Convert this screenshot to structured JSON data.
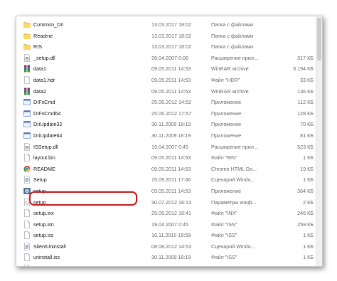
{
  "files": [
    {
      "name": "Common_Dri",
      "date": "13.03.2017 18:02",
      "type": "Папка с файлами",
      "size": "",
      "icon": "folder-icon"
    },
    {
      "name": "Readme",
      "date": "13.03.2017 18:02",
      "type": "Папка с файлами",
      "size": "",
      "icon": "folder-icon"
    },
    {
      "name": "RIS",
      "date": "13.03.2017 18:02",
      "type": "Папка с файлами",
      "size": "",
      "icon": "folder-icon"
    },
    {
      "name": "_setup.dll",
      "date": "28.04.2007 0:06",
      "type": "Расширение прил...",
      "size": "317 КБ",
      "icon": "dll-icon"
    },
    {
      "name": "data1",
      "date": "09.05.2011 14:53",
      "type": "WinRAR archive",
      "size": "3 194 КБ",
      "icon": "archive-icon"
    },
    {
      "name": "data1.hdr",
      "date": "09.05.2011 14:53",
      "type": "Файл \"HDR\"",
      "size": "33 КБ",
      "icon": "file-icon"
    },
    {
      "name": "data2",
      "date": "09.05.2011 14:53",
      "type": "WinRAR archive",
      "size": "136 КБ",
      "icon": "archive-icon"
    },
    {
      "name": "DIFxCmd",
      "date": "25.06.2012 14:52",
      "type": "Приложение",
      "size": "112 КБ",
      "icon": "app-icon"
    },
    {
      "name": "DIFxCmd64",
      "date": "25.06.2012 17:57",
      "type": "Приложение",
      "size": "128 КБ",
      "icon": "app-icon"
    },
    {
      "name": "DriUpdate32",
      "date": "30.11.2009 18:19",
      "type": "Приложение",
      "size": "70 КБ",
      "icon": "app-icon"
    },
    {
      "name": "DriUpdate64",
      "date": "30.11.2009 18:19",
      "type": "Приложение",
      "size": "81 КБ",
      "icon": "app-icon"
    },
    {
      "name": "ISSetup.dll",
      "date": "19.04.2007 0:45",
      "type": "Расширение прил...",
      "size": "523 КБ",
      "icon": "dll-icon"
    },
    {
      "name": "layout.bin",
      "date": "09.05.2011 14:53",
      "type": "Файл \"BIN\"",
      "size": "1 КБ",
      "icon": "file-icon"
    },
    {
      "name": "README",
      "date": "09.05.2011 14:53",
      "type": "Chrome HTML Do...",
      "size": "19 КБ",
      "icon": "chrome-icon"
    },
    {
      "name": "Setup",
      "date": "15.09.2011 17:46",
      "type": "Сценарий Windo...",
      "size": "1 КБ",
      "icon": "script-icon"
    },
    {
      "name": "setup",
      "date": "09.05.2011 14:53",
      "type": "Приложение",
      "size": "364 КБ",
      "icon": "setup-icon"
    },
    {
      "name": "setup",
      "date": "30.07.2012 16:13",
      "type": "Параметры конф...",
      "size": "2 КБ",
      "icon": "ini-icon"
    },
    {
      "name": "setup.inx",
      "date": "25.06.2012 16:41",
      "type": "Файл \"INX\"",
      "size": "246 КБ",
      "icon": "file-icon"
    },
    {
      "name": "setup.isn",
      "date": "19.04.2007 0:45",
      "type": "Файл \"ISN\"",
      "size": "259 КБ",
      "icon": "file-icon"
    },
    {
      "name": "setup.iss",
      "date": "10.11.2010 18:59",
      "type": "Файл \"ISS\"",
      "size": "1 КБ",
      "icon": "file-icon"
    },
    {
      "name": "SilentUninstall",
      "date": "08.08.2012 14:53",
      "type": "Сценарий Windo...",
      "size": "1 КБ",
      "icon": "script-icon"
    },
    {
      "name": "uninstall.iss",
      "date": "30.11.2009 18:19",
      "type": "Файл \"ISS\"",
      "size": "1 КБ",
      "icon": "file-icon"
    },
    {
      "name": "update.iss",
      "date": "30.04.2009 14:55",
      "type": "Файл \"ISS\"",
      "size": "1 КБ",
      "icon": "file-icon"
    }
  ]
}
